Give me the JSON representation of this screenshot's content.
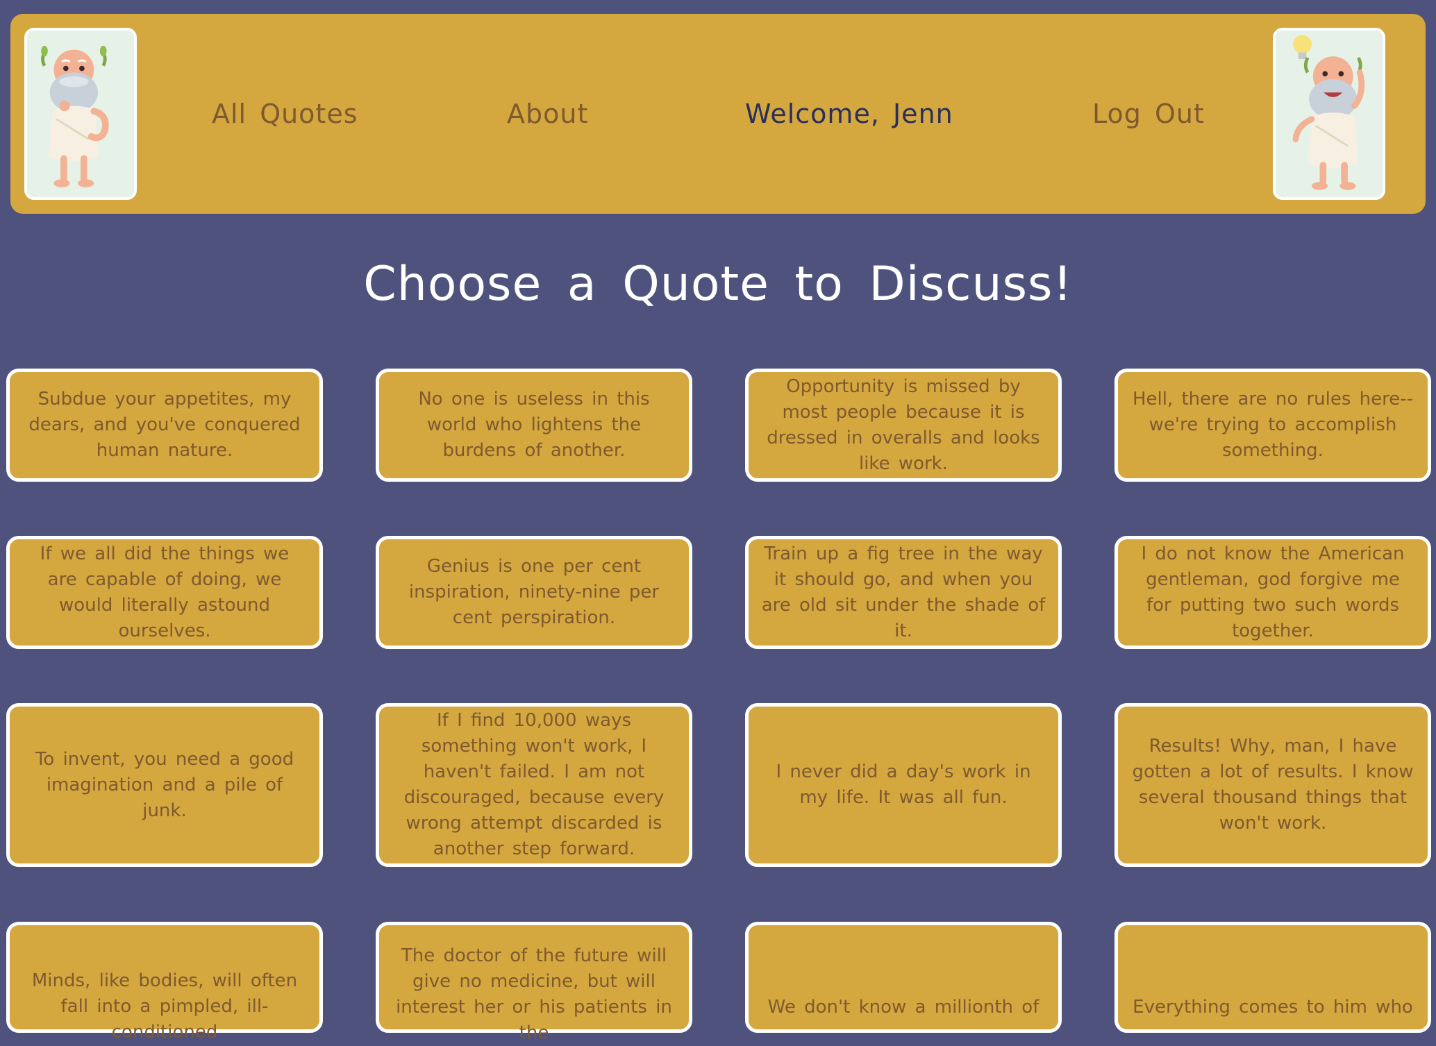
{
  "header": {
    "nav": {
      "all_quotes": "All Quotes",
      "about": "About",
      "welcome": "Welcome, Jenn",
      "logout": "Log Out"
    },
    "colors": {
      "bar": "#d4a73f",
      "link": "#7f5a2e",
      "welcome": "#2a2f5c"
    },
    "left_avatar_icon": "thinking-philosopher-icon",
    "right_avatar_icon": "idea-philosopher-icon"
  },
  "main": {
    "title": "Choose a Quote to Discuss!",
    "background": "#4f527c",
    "quotes": [
      "Subdue your appetites, my dears, and you've conquered human nature.",
      "No one is useless in this world who lightens the burdens of another.",
      "Opportunity is missed by most people because it is dressed in overalls and looks like work.",
      "Hell, there are no rules here-- we're trying to accomplish something.",
      "If we all did the things we are capable of doing, we would literally astound ourselves.",
      "Genius is one per cent inspiration, ninety-nine per cent perspiration.",
      "Train up a fig tree in the way it should go, and when you are old sit under the shade of it.",
      "I do not know the American gentleman, god forgive me for putting two such words together.",
      "To invent, you need a good imagination and a pile of junk.",
      "If I find 10,000 ways something won't work, I haven't failed. I am not discouraged, because every wrong attempt discarded is another step forward.",
      "I never did a day's work in my life. It was all fun.",
      "Results! Why, man, I have gotten a lot of results. I know several thousand things that won't work.",
      "Minds, like bodies, will often fall into a pimpled, ill-conditioned",
      "The doctor of the future will give no medicine, but will interest her or his patients in the",
      "We don't know a millionth of",
      "Everything comes to him who"
    ]
  }
}
